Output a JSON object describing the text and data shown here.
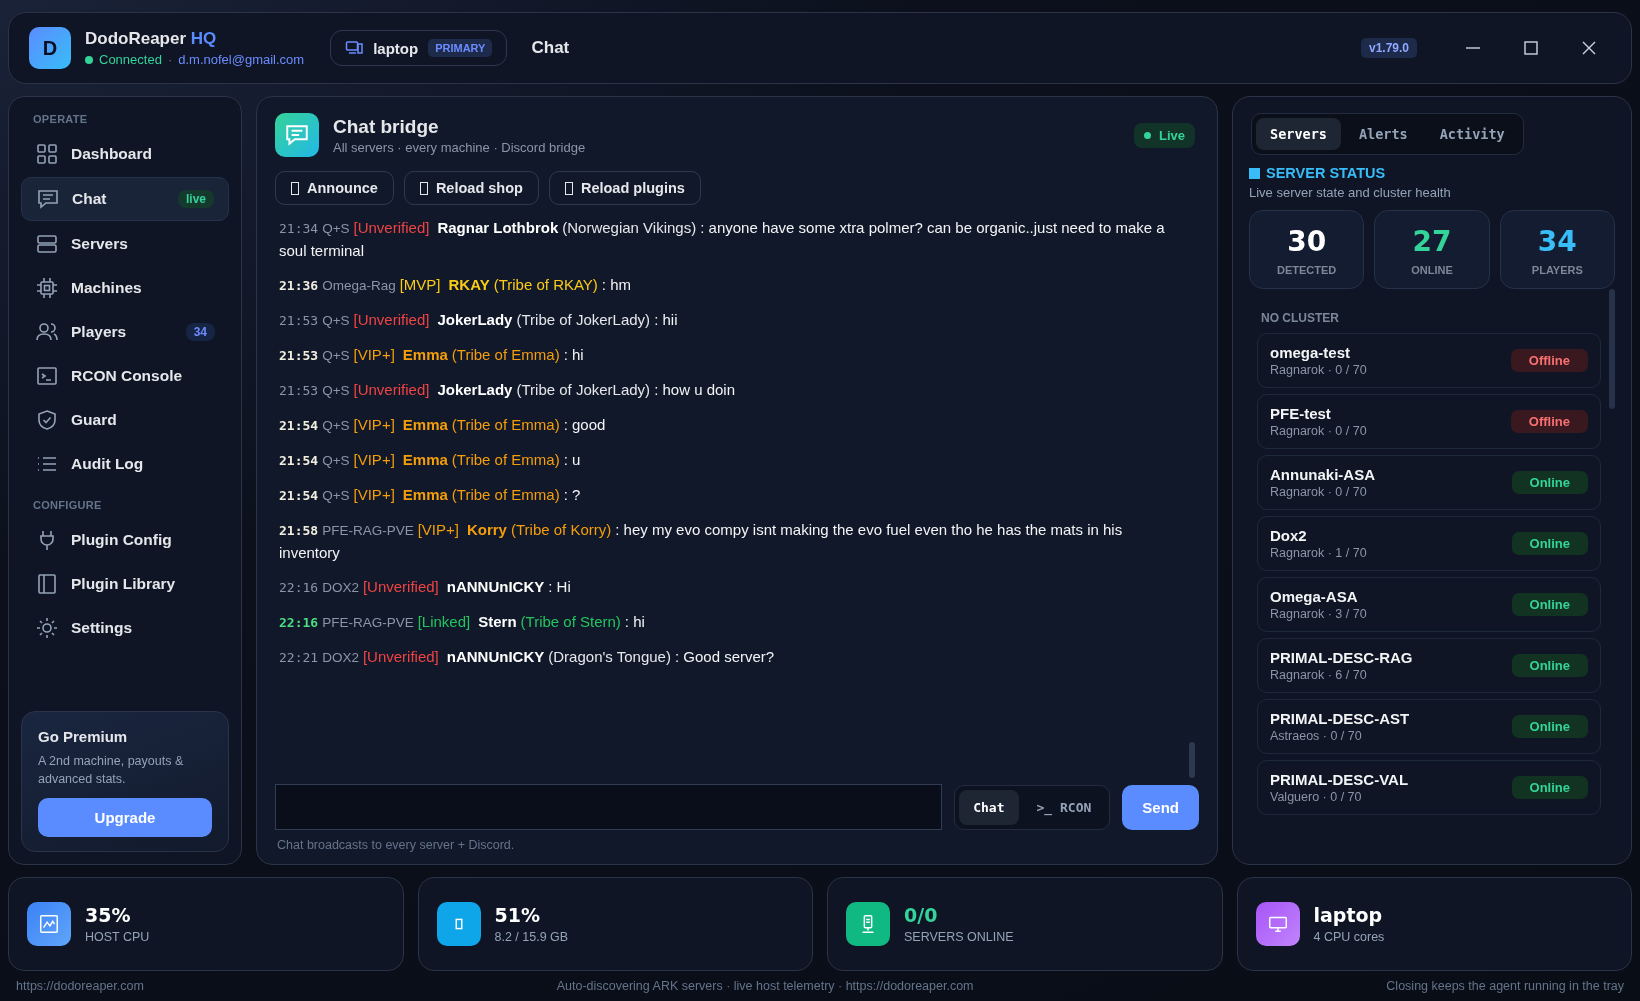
{
  "app": {
    "avatar": "D",
    "title": "DodoReaper",
    "title_accent": "HQ",
    "status": "Connected",
    "connected": true,
    "separator": "·",
    "email": "d.m.nofel@gmail.com"
  },
  "machine": {
    "name": "laptop",
    "badge": "PRIMARY"
  },
  "page_title": "Chat",
  "version": "v1.79.0",
  "sidebar": {
    "sections": [
      {
        "label": "OPERATE",
        "items": [
          {
            "label": "Dashboard",
            "selected": false
          },
          {
            "label": "Chat",
            "selected": true,
            "badge": "live"
          },
          {
            "label": "Servers",
            "selected": false
          },
          {
            "label": "Machines",
            "selected": false
          },
          {
            "label": "Players",
            "selected": false,
            "badge": "34"
          },
          {
            "label": "RCON Console",
            "selected": false
          },
          {
            "label": "Guard",
            "selected": false
          },
          {
            "label": "Audit Log",
            "selected": false
          }
        ]
      },
      {
        "label": "CONFIGURE",
        "items": [
          {
            "label": "Plugin Config",
            "selected": false
          },
          {
            "label": "Plugin Library",
            "selected": false
          },
          {
            "label": "Settings",
            "selected": false
          }
        ]
      }
    ],
    "promo": {
      "title": "Go Premium",
      "text": "A 2nd machine, payouts & advanced stats.",
      "button": "Upgrade"
    }
  },
  "chat": {
    "title": "Chat bridge",
    "subtitle": "All servers · every machine · Discord bridge",
    "live": "Live",
    "actions": [
      "Announce",
      "Reload shop",
      "Reload plugins"
    ],
    "messages": [
      {
        "time": "21:34",
        "server": "Q+S",
        "tag": "[Unverified]",
        "kind": "unverified",
        "name": "Ragnar Lothbrok",
        "tribe": "(Norwegian Vikings)",
        "text": ": anyone have some xtra polmer? can be organic..just need to make a soul terminal"
      },
      {
        "time": "21:36",
        "server": "Omega-Rag",
        "tag": "[MVP]",
        "kind": "mvp",
        "name": "RKAY",
        "tribe": "(Tribe of RKAY)",
        "text": ": hm"
      },
      {
        "time": "21:53",
        "server": "Q+S",
        "tag": "[Unverified]",
        "kind": "unverified",
        "name": "JokerLady",
        "tribe": "(Tribe of JokerLady)",
        "text": ": hii"
      },
      {
        "time": "21:53",
        "server": "Q+S",
        "tag": "[VIP+]",
        "kind": "vip",
        "name": "Emma",
        "tribe": "(Tribe of Emma)",
        "text": ": hi"
      },
      {
        "time": "21:53",
        "server": "Q+S",
        "tag": "[Unverified]",
        "kind": "unverified",
        "name": "JokerLady",
        "tribe": "(Tribe of JokerLady)",
        "text": ": how u doin"
      },
      {
        "time": "21:54",
        "server": "Q+S",
        "tag": "[VIP+]",
        "kind": "vip",
        "name": "Emma",
        "tribe": "(Tribe of Emma)",
        "text": ": good"
      },
      {
        "time": "21:54",
        "server": "Q+S",
        "tag": "[VIP+]",
        "kind": "vip",
        "name": "Emma",
        "tribe": "(Tribe of Emma)",
        "text": ": u"
      },
      {
        "time": "21:54",
        "server": "Q+S",
        "tag": "[VIP+]",
        "kind": "vip",
        "name": "Emma",
        "tribe": "(Tribe of Emma)",
        "text": ": ?"
      },
      {
        "time": "21:58",
        "server": "PFE-RAG-PVE",
        "tag": "[VIP+]",
        "kind": "vip",
        "name": "Korry",
        "tribe": "(Tribe of Korry)",
        "text": ": hey my evo compy isnt making the evo fuel even tho he has the mats in his inventory"
      },
      {
        "time": "22:16",
        "server": "DOX2",
        "tag": "[Unverified]",
        "kind": "unverified",
        "name": "nANNUnICKY",
        "text": ": Hi"
      },
      {
        "time": "22:16",
        "server": "PFE-RAG-PVE",
        "tag": "[Linked]",
        "kind": "linked",
        "name": "Stern",
        "tribe": "(Tribe of Stern)",
        "text": ": hi"
      },
      {
        "time": "22:21",
        "server": "DOX2",
        "tag": "[Unverified]",
        "kind": "unverified",
        "name": "nANNUnICKY",
        "tribe": "(Dragon's Tongue)",
        "text": ": Good server?"
      }
    ],
    "modes": [
      {
        "label": "Chat",
        "selected": true
      },
      {
        "label": ">_ RCON",
        "selected": false
      }
    ],
    "send": "Send",
    "hint": "Chat broadcasts to every server + Discord."
  },
  "status_panel": {
    "tabs": [
      {
        "label": "Servers",
        "selected": true
      },
      {
        "label": "Alerts",
        "selected": false
      },
      {
        "label": "Activity",
        "selected": false
      }
    ],
    "title": "SERVER STATUS",
    "subtitle": "Live server state and cluster health",
    "stats": [
      {
        "value": "30",
        "label": "DETECTED",
        "kind": "neutral"
      },
      {
        "value": "27",
        "label": "ONLINE",
        "kind": "good"
      },
      {
        "value": "34",
        "label": "PLAYERS",
        "kind": "info"
      }
    ],
    "group": "NO CLUSTER",
    "servers": [
      {
        "name": "omega-test",
        "details": "Ragnarok · 0 / 70",
        "status": "Offline",
        "online": false
      },
      {
        "name": "PFE-test",
        "details": "Ragnarok · 0 / 70",
        "status": "Offline",
        "online": false
      },
      {
        "name": "Annunaki-ASA",
        "details": "Ragnarok · 0 / 70",
        "status": "Online",
        "online": true
      },
      {
        "name": "Dox2",
        "details": "Ragnarok · 1 / 70",
        "status": "Online",
        "online": true
      },
      {
        "name": "Omega-ASA",
        "details": "Ragnarok · 3 / 70",
        "status": "Online",
        "online": true
      },
      {
        "name": "PRIMAL-DESC-RAG",
        "details": "Ragnarok · 6 / 70",
        "status": "Online",
        "online": true
      },
      {
        "name": "PRIMAL-DESC-AST",
        "details": "Astraeos · 0 / 70",
        "status": "Online",
        "online": true
      },
      {
        "name": "PRIMAL-DESC-VAL",
        "details": "Valguero · 0 / 70",
        "status": "Online",
        "online": true
      }
    ]
  },
  "metrics": [
    {
      "value": "35%",
      "label": "HOST CPU",
      "kind": "plain"
    },
    {
      "value": "51%",
      "label": "8.2 / 15.9 GB",
      "kind": "plain"
    },
    {
      "value": "0/0",
      "label": "SERVERS ONLINE",
      "kind": "good"
    },
    {
      "value": "laptop",
      "label": "4 CPU cores",
      "kind": "plain"
    }
  ],
  "footer": {
    "left": "https://dodoreaper.com",
    "center": "Auto-discovering ARK servers · live host telemetry · https://dodoreaper.com",
    "right": "Closing keeps the agent running in the tray"
  }
}
